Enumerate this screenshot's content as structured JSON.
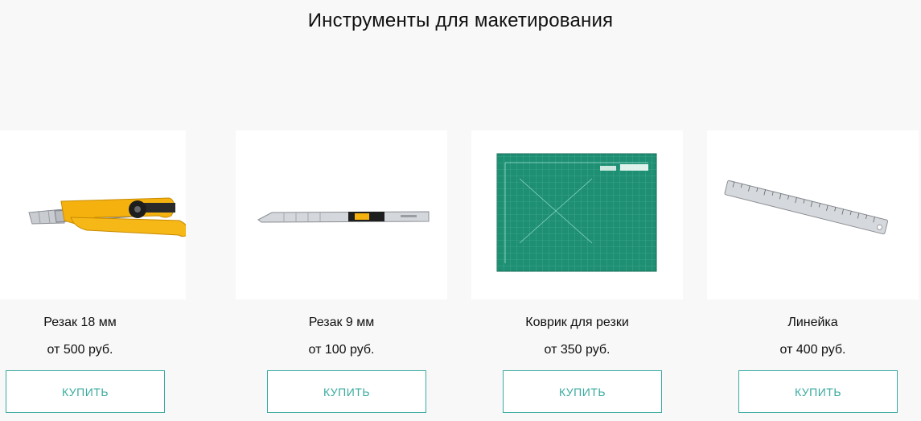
{
  "page": {
    "title": "Инструменты для макетирования"
  },
  "products": [
    {
      "name": "Резак 18 мм",
      "price": "от 500 руб.",
      "button": "КУПИТЬ"
    },
    {
      "name": "Резак 9 мм",
      "price": "от 100 руб.",
      "button": "КУПИТЬ"
    },
    {
      "name": "Коврик для резки",
      "price": "от 350 руб.",
      "button": "КУПИТЬ"
    },
    {
      "name": "Линейка",
      "price": "от 400 руб.",
      "button": "КУПИТЬ"
    }
  ],
  "colors": {
    "accent": "#3aaaa0",
    "background": "#f8f8f8",
    "card": "#ffffff",
    "mat_green": "#1f8f74",
    "cutter_yellow": "#f5b20f"
  },
  "icons": [
    "cutter-18mm-image",
    "cutter-9mm-image",
    "cutting-mat-image",
    "ruler-image"
  ]
}
